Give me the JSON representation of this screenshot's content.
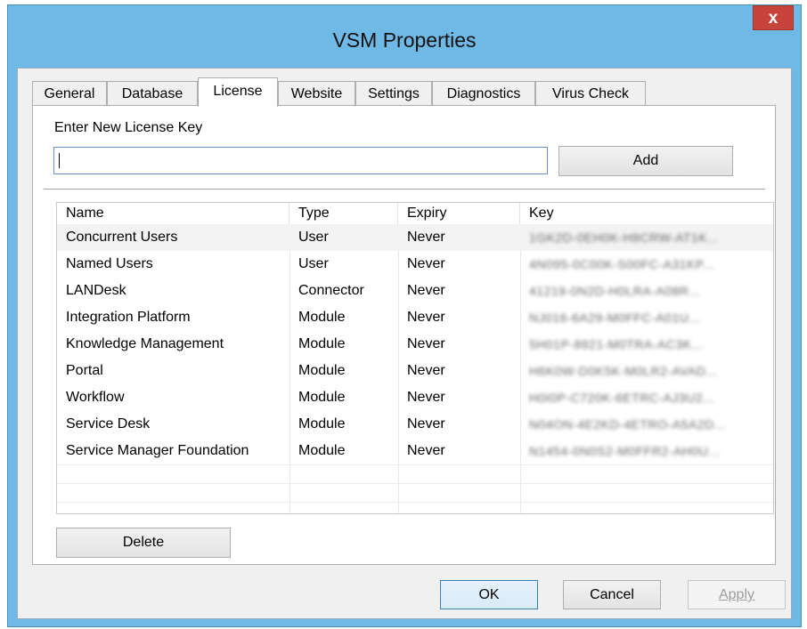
{
  "window": {
    "title": "VSM Properties",
    "close_glyph": "x"
  },
  "tabs": [
    "General",
    "Database",
    "License",
    "Website",
    "Settings",
    "Diagnostics",
    "Virus Check"
  ],
  "active_tab": "License",
  "license": {
    "enter_label": "Enter New License Key",
    "key_value": "",
    "add_label": "Add",
    "delete_label": "Delete",
    "columns": [
      "Name",
      "Type",
      "Expiry",
      "Key"
    ],
    "rows": [
      {
        "name": "Concurrent Users",
        "type": "User",
        "expiry": "Never",
        "key": "1GK2D-0EH0K-H8CRW-AT1K..."
      },
      {
        "name": "Named Users",
        "type": "User",
        "expiry": "Never",
        "key": "4N095-0C00K-S00FC-A31KP..."
      },
      {
        "name": "LANDesk",
        "type": "Connector",
        "expiry": "Never",
        "key": "41219-0N2D-H0LRA-A08R..."
      },
      {
        "name": "Integration Platform",
        "type": "Module",
        "expiry": "Never",
        "key": "NJ016-6A29-M0FFC-A01U..."
      },
      {
        "name": "Knowledge Management",
        "type": "Module",
        "expiry": "Never",
        "key": "5H01P-8921-M0TRA-AC3K..."
      },
      {
        "name": "Portal",
        "type": "Module",
        "expiry": "Never",
        "key": "H6K0W-D0K5K-M0LR2-AVAD..."
      },
      {
        "name": "Workflow",
        "type": "Module",
        "expiry": "Never",
        "key": "H0I0P-C720K-6ETRC-AJ3U2..."
      },
      {
        "name": "Service Desk",
        "type": "Module",
        "expiry": "Never",
        "key": "N04ON-4E2KD-4ETRO-A5A2D..."
      },
      {
        "name": "Service Manager Foundation",
        "type": "Module",
        "expiry": "Never",
        "key": "N1454-0N0S2-M0FFR2-AH0U..."
      }
    ],
    "selected_row": 0
  },
  "buttons": {
    "ok": "OK",
    "cancel": "Cancel",
    "apply": "Apply",
    "apply_disabled": true
  },
  "colors": {
    "titlebar": "#6fb9e6",
    "close": "#c7443a",
    "focus_border": "#3c7fb1"
  }
}
